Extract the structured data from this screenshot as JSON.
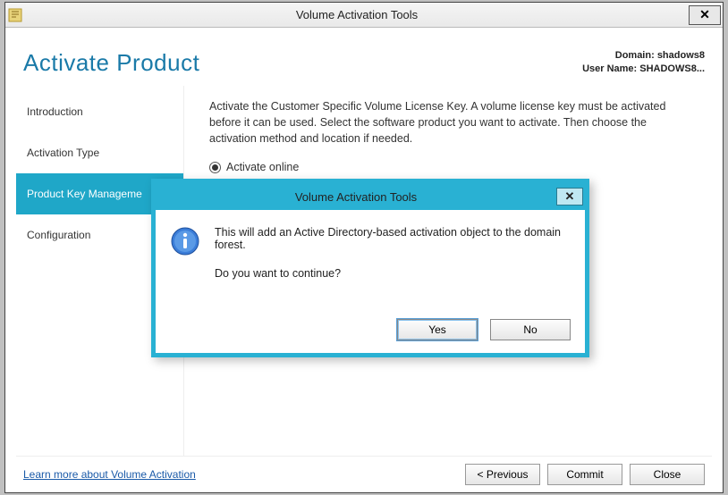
{
  "window": {
    "title": "Volume Activation Tools",
    "close_glyph": "✕"
  },
  "header": {
    "page_title": "Activate Product",
    "domain_label": "Domain: ",
    "domain_value": "shadows8",
    "user_label": "User Name: ",
    "user_value": "SHADOWS8..."
  },
  "sidebar": {
    "items": [
      {
        "label": "Introduction",
        "active": false
      },
      {
        "label": "Activation Type",
        "active": false
      },
      {
        "label": "Product Key Manageme",
        "active": true
      },
      {
        "label": "Configuration",
        "active": false
      }
    ]
  },
  "main": {
    "intro_text": "Activate the Customer Specific Volume License Key. A volume license key must be activated before it can be used. Select the software product you want to activate. Then choose the activation method and location if needed.",
    "radio_label": "Activate online"
  },
  "footer": {
    "link": "Learn more about Volume Activation",
    "prev": "<  Previous",
    "commit": "Commit",
    "close": "Close"
  },
  "dialog": {
    "title": "Volume Activation Tools",
    "close_glyph": "✕",
    "message": "This will add an Active Directory-based activation object to the domain forest.",
    "confirm": "Do you want to continue?",
    "yes": "Yes",
    "no": "No"
  }
}
